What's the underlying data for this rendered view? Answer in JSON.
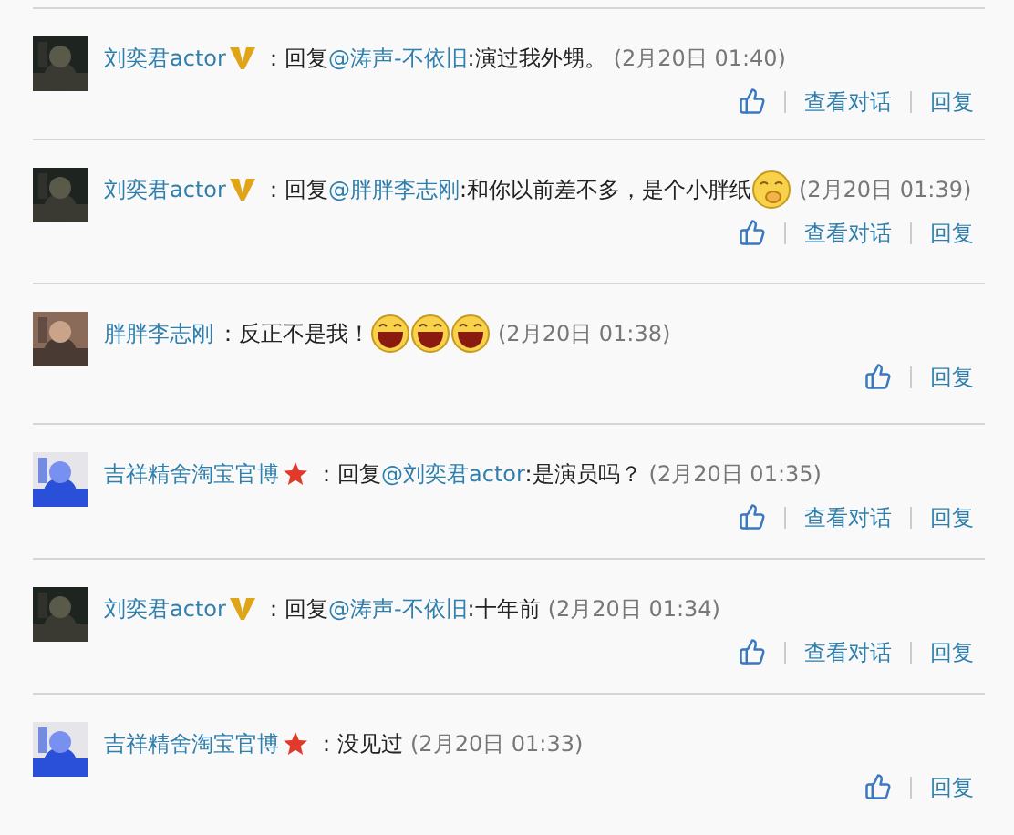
{
  "comments": [
    {
      "author": "刘奕君actor",
      "badge": {
        "kind": "verified"
      },
      "prefix": "：回复",
      "mention": "@涛声-不依旧",
      "text": ":演过我外甥。",
      "time": "(2月20日 01:40)",
      "actions": [
        "查看对话",
        "回复"
      ]
    },
    {
      "author": "刘奕君actor",
      "badge": {
        "kind": "verified"
      },
      "prefix": "：回复",
      "mention": "@胖胖李志刚",
      "text": ":和你以前差不多，是个小胖纸",
      "emojis": [
        {
          "kind": "shy"
        }
      ],
      "time": "(2月20日 01:39)",
      "actions": [
        "查看对话",
        "回复"
      ]
    },
    {
      "author": "胖胖李志刚",
      "text": "：反正不是我！",
      "emojis": [
        {
          "kind": "laugh"
        },
        {
          "kind": "laugh"
        },
        {
          "kind": "laugh"
        }
      ],
      "time": "(2月20日 01:38)",
      "actions": [
        "回复"
      ]
    },
    {
      "author": "吉祥精舍淘宝官博",
      "badge": {
        "kind": "star"
      },
      "prefix": "：回复",
      "mention": "@刘奕君actor",
      "text": ":是演员吗？",
      "time": "(2月20日 01:35)",
      "actions": [
        "查看对话",
        "回复"
      ]
    },
    {
      "author": "刘奕君actor",
      "badge": {
        "kind": "verified"
      },
      "prefix": "：回复",
      "mention": "@涛声-不依旧",
      "text": ":十年前",
      "time": "(2月20日 01:34)",
      "actions": [
        "查看对话",
        "回复"
      ]
    },
    {
      "author": "吉祥精舍淘宝官博",
      "badge": {
        "kind": "star"
      },
      "text": "：没见过",
      "time": "(2月20日 01:33)",
      "actions": [
        "回复"
      ]
    }
  ]
}
